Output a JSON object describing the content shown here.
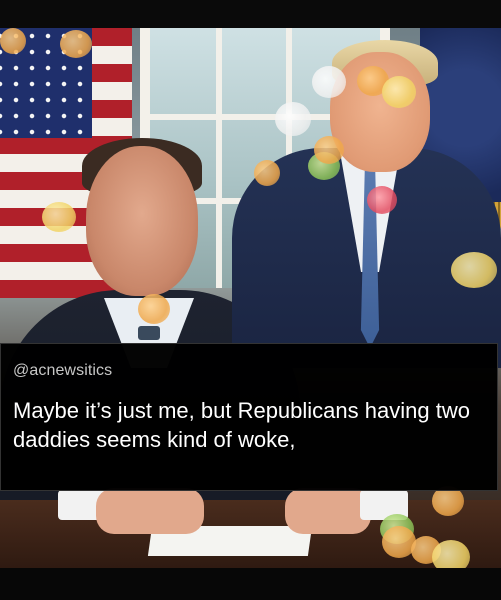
{
  "post": {
    "handle": "@acnewsitics",
    "text": "Maybe it’s just me, but Republicans having two daddies seems kind of woke,"
  },
  "colors": {
    "caption_background": "#000000",
    "caption_text": "#ffffff",
    "handle_text": "#c7c7c7"
  },
  "image": {
    "scene": "photo-with-two-men-in-suits",
    "icons": [
      "bokeh-lights",
      "us-flag"
    ]
  }
}
